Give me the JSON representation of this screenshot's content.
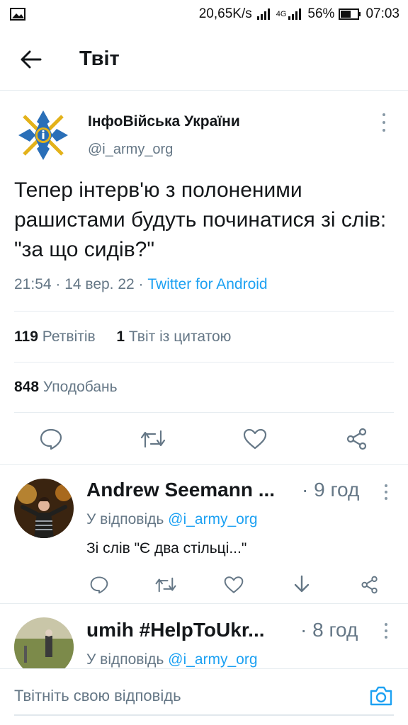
{
  "status_bar": {
    "speed": "20,65K/s",
    "network": "4G",
    "battery": "56%",
    "time": "07:03"
  },
  "header": {
    "title": "Твіт"
  },
  "tweet": {
    "author_name": "ІнфоВійська України",
    "author_handle": "@i_army_org",
    "text": "Тепер інтерв'ю з полоненими рашистами будуть починатися зі слів: \"за що сидів?\"",
    "timestamp": "21:54 · 14 вер. 22 · ",
    "source": "Twitter for Android",
    "retweets_count": "119",
    "retweets_label": "Ретвітів",
    "quotes_count": "1",
    "quotes_label": "Твіт із цитатою",
    "likes_count": "848",
    "likes_label": "Уподобань"
  },
  "replies": [
    {
      "name": "Andrew Seemann ...",
      "time": "· 9 год",
      "reply_prefix": "У відповідь ",
      "mention": "@i_army_org",
      "text": "Зі слів \"Є два стільці...\""
    },
    {
      "name": "umih #HelpToUkr...",
      "time": "· 8 год",
      "reply_prefix": "У відповідь ",
      "mention": "@i_army_org"
    }
  ],
  "composer": {
    "placeholder": "Твітніть свою відповідь"
  },
  "colors": {
    "accent": "#1da1f2",
    "secondary": "#657786",
    "action_icon": "#657786"
  }
}
